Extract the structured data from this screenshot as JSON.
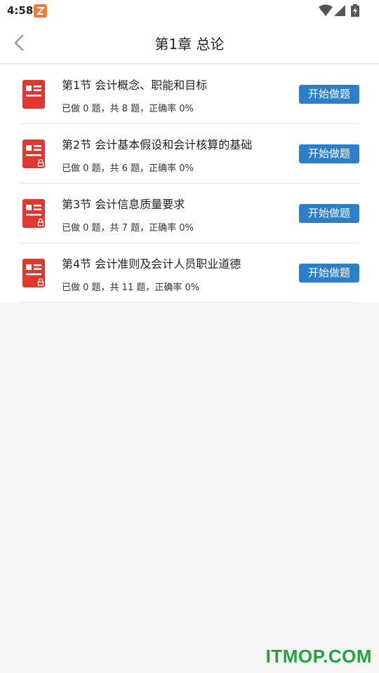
{
  "status_bar": {
    "time": "4:58",
    "notification_icon": "app-logo-icon",
    "system_icons": [
      "wifi-icon",
      "cell-signal-icon",
      "battery-charging-icon"
    ]
  },
  "header": {
    "back_icon": "chevron-left-icon",
    "title": "第1章 总论"
  },
  "sections": [
    {
      "title": "第1节 会计概念、职能和目标",
      "meta": "已做 0 题，共 8 题，正确率 0%",
      "button": "开始做题",
      "locked": false
    },
    {
      "title": "第2节 会计基本假设和会计核算的基础",
      "meta": "已做 0 题，共 6 题，正确率 0%",
      "button": "开始做题",
      "locked": true
    },
    {
      "title": "第3节 会计信息质量要求",
      "meta": "已做 0 题，共 7 题，正确率 0%",
      "button": "开始做题",
      "locked": true
    },
    {
      "title": "第4节 会计准则及会计人员职业道德",
      "meta": "已做 0 题，共 11 题，正确率 0%",
      "button": "开始做题",
      "locked": true
    }
  ],
  "colors": {
    "accent_button": "#2d7ec8",
    "doc_icon": "#e0382e",
    "watermark": "#22a33c"
  },
  "watermark": "ITMOP.COM"
}
